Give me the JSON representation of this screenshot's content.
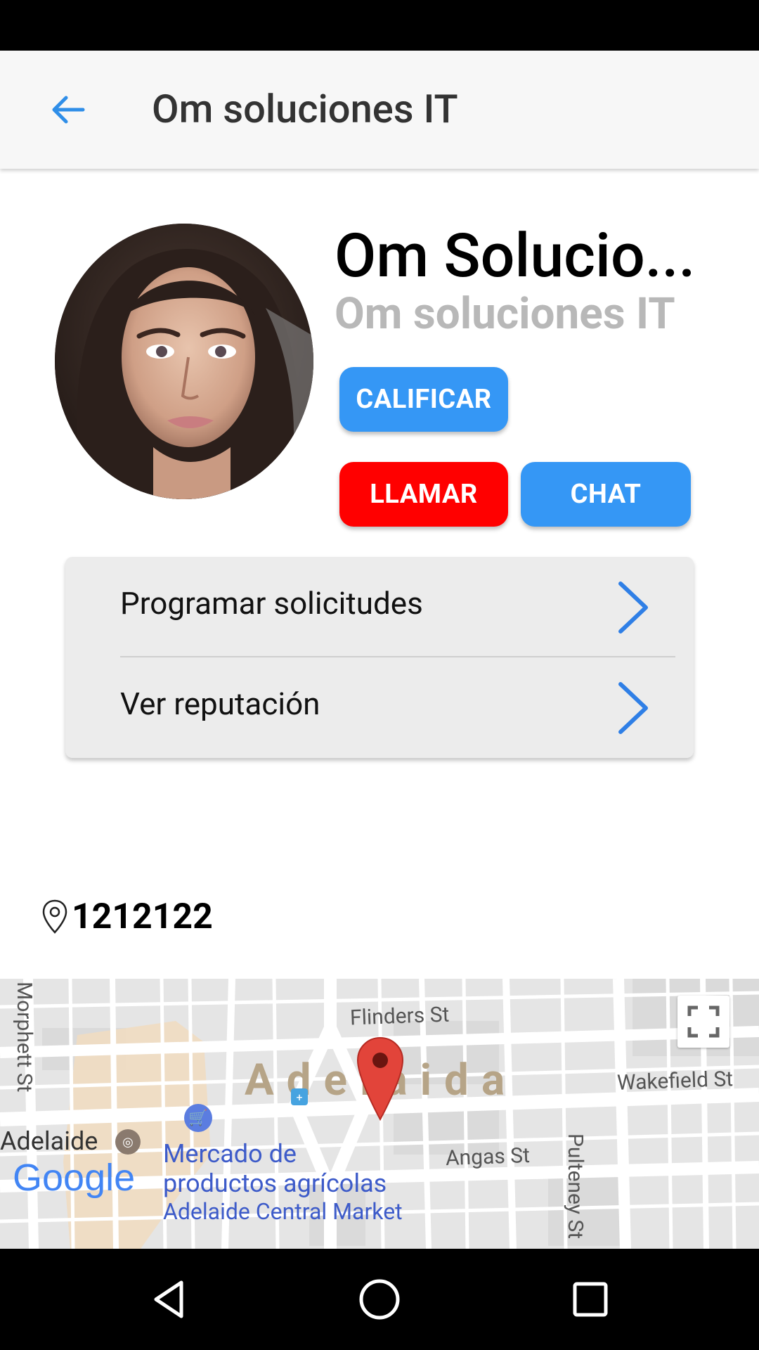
{
  "app_bar": {
    "title": "Om soluciones IT",
    "back_icon": "arrow-left-icon",
    "accent": "#2f8ee8"
  },
  "profile": {
    "name": "Om Solucio...",
    "subtitle": "Om soluciones IT",
    "avatar": "profile-photo"
  },
  "actions": {
    "calificar": "CALIFICAR",
    "llamar": "LLAMAR",
    "chat": "CHAT",
    "colors": {
      "primary": "#3597f5",
      "danger": "#ff0000"
    }
  },
  "menu": {
    "items": [
      {
        "label": "Programar solicitudes",
        "icon": "chevron-right-icon"
      },
      {
        "label": "Ver reputación",
        "icon": "chevron-right-icon"
      }
    ]
  },
  "location": {
    "icon": "location-pin-icon",
    "text": "1212122"
  },
  "map": {
    "city_label": "Adelaida",
    "streets": [
      "Flinders St",
      "Wakefield St",
      "Angas St",
      "Pulteney St",
      "Morphett St"
    ],
    "poi_adelaide": "Adelaide",
    "poi_market_line1": "Mercado de",
    "poi_market_line2": "productos agrícolas",
    "poi_market_line3": "Adelaide Central Market",
    "logo": "Google",
    "fullscreen_icon": "fullscreen-icon",
    "marker_icon": "map-marker-icon"
  },
  "nav": {
    "back": "triangle-back-icon",
    "home": "circle-home-icon",
    "recents": "square-recents-icon"
  }
}
